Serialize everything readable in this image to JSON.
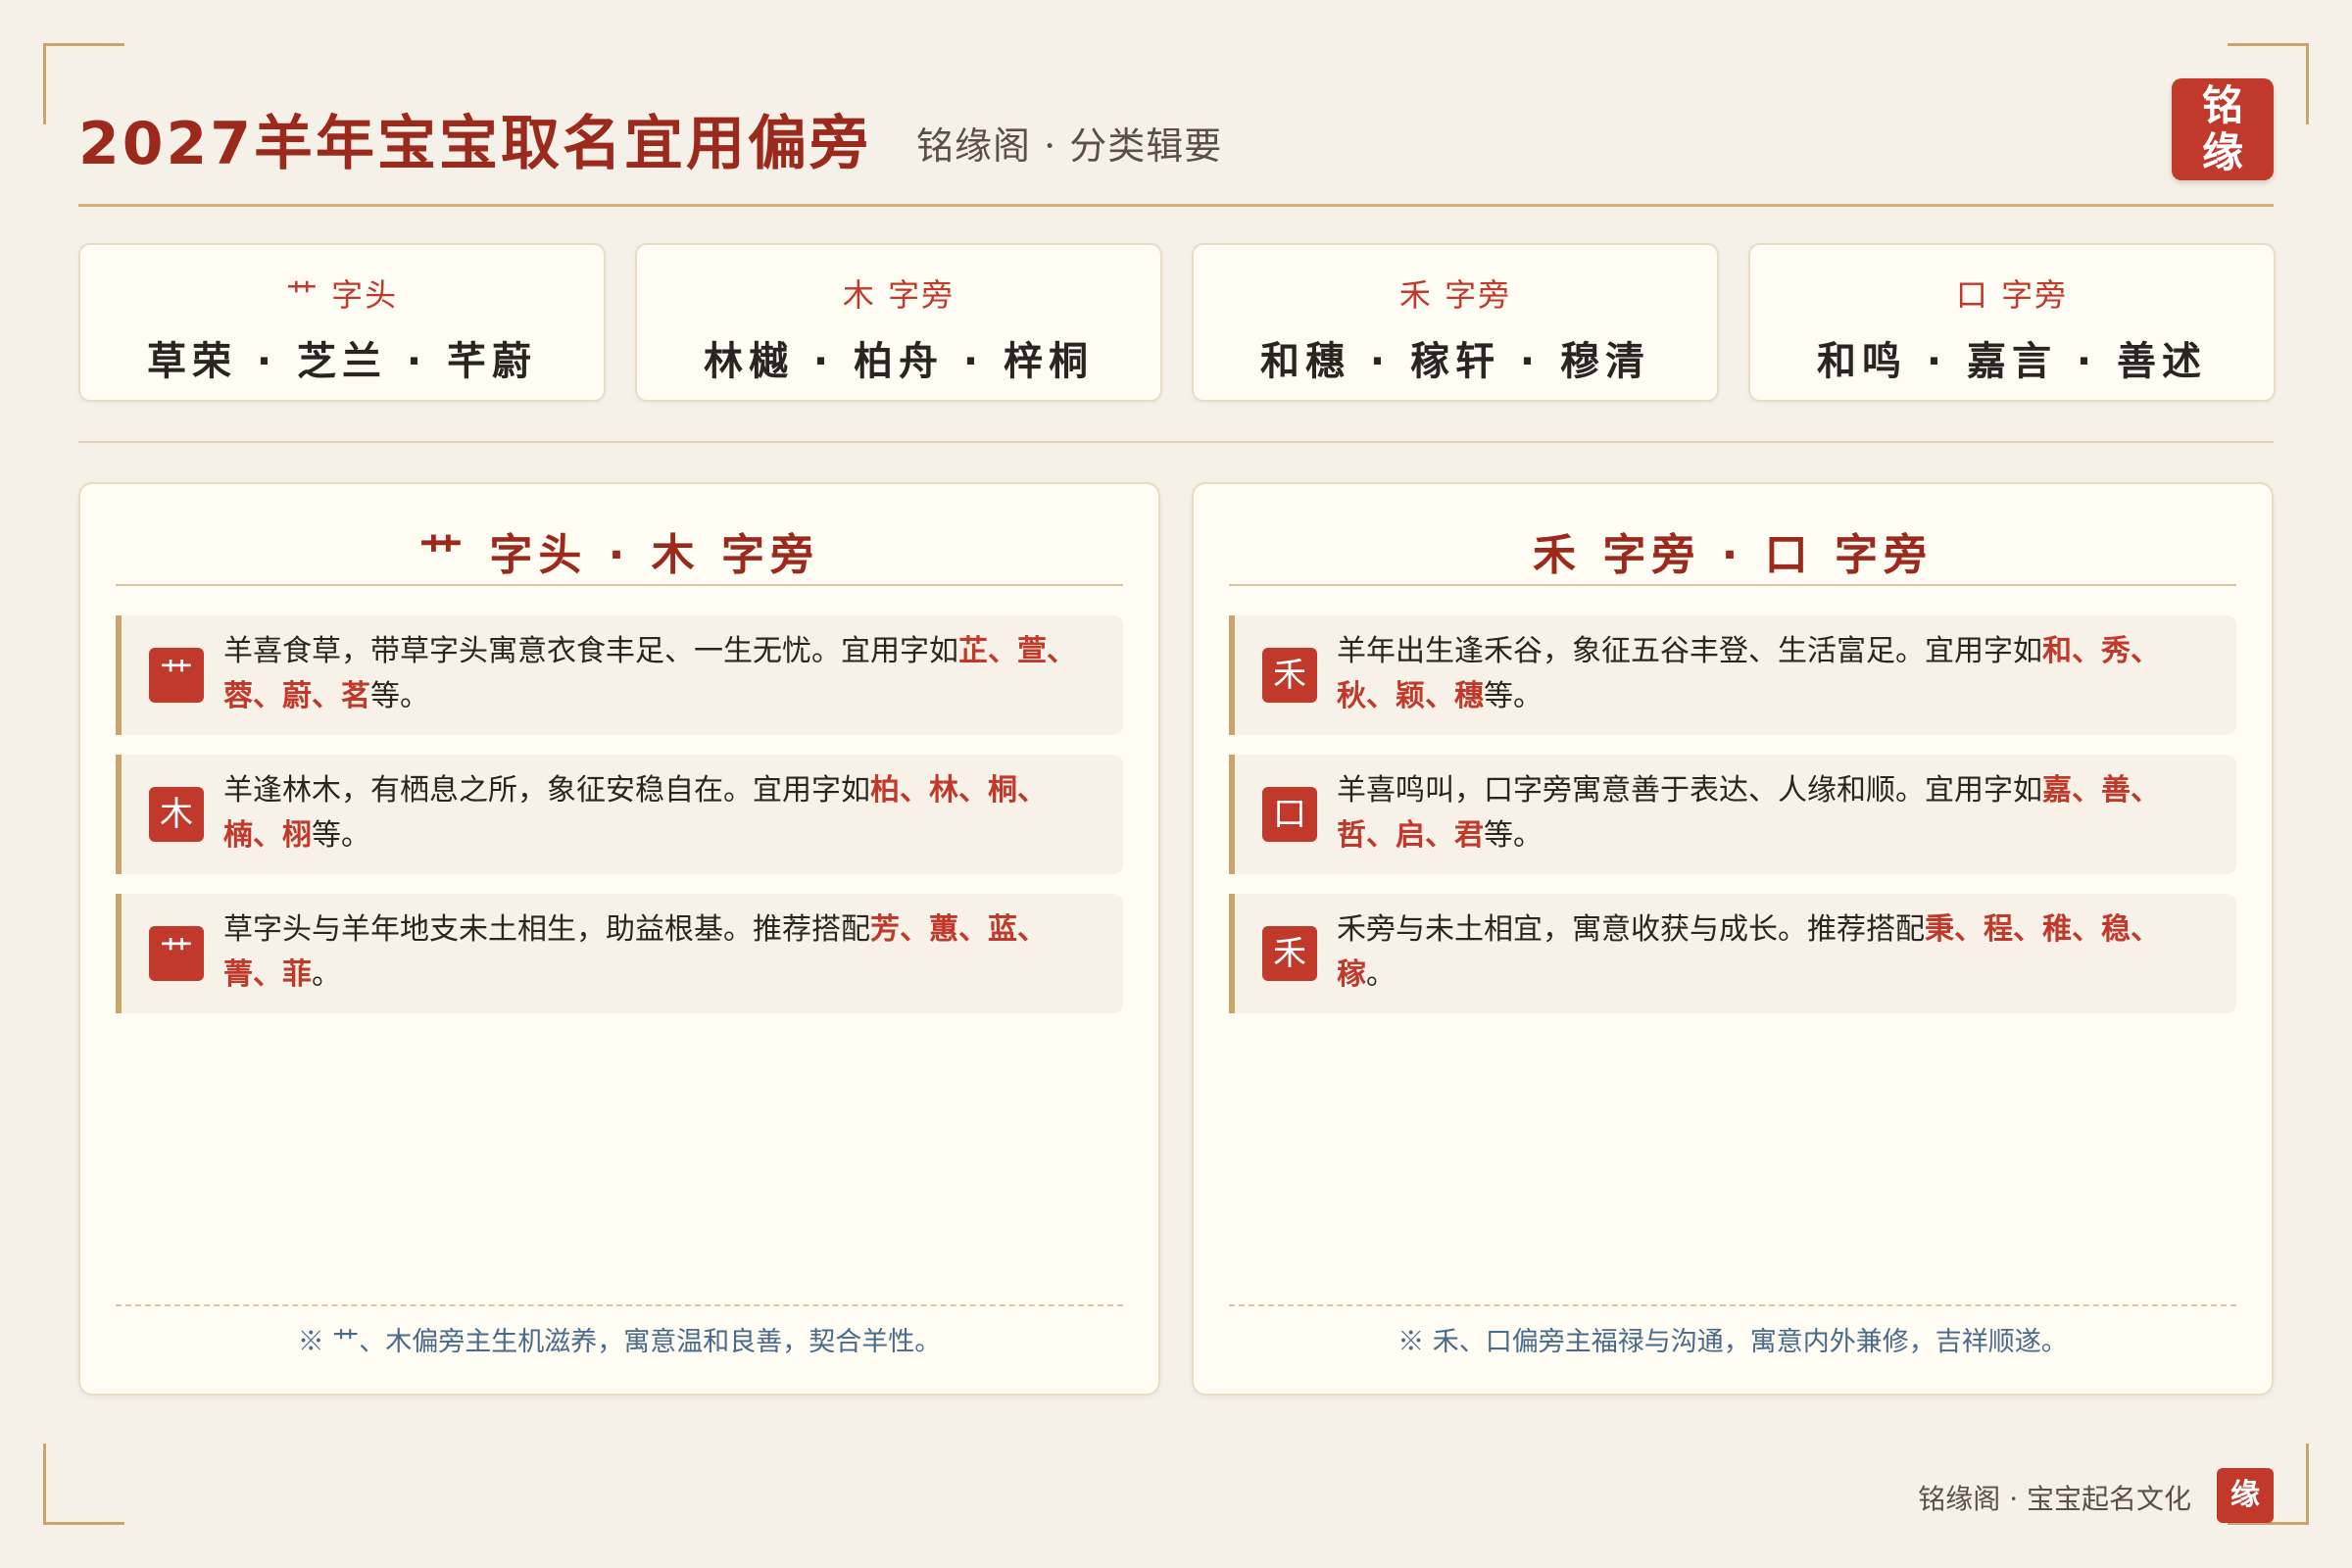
{
  "header": {
    "title": "2027羊年宝宝取名宜用偏旁",
    "subtitle": "铭缘阁 · 分类辑要",
    "seal_top": "铭",
    "seal_bottom": "缘"
  },
  "cards": [
    {
      "radical": "艹 字头",
      "names": "草荣 · 芝兰 · 芊蔚"
    },
    {
      "radical": "木 字旁",
      "names": "林樾 · 柏舟 · 梓桐"
    },
    {
      "radical": "禾 字旁",
      "names": "和穗 · 稼轩 · 穆清"
    },
    {
      "radical": "口 字旁",
      "names": "和鸣 · 嘉言 · 善述"
    }
  ],
  "panels": [
    {
      "title": "艹 字头 · 木 字旁",
      "items": [
        {
          "icon": "艹",
          "text": "羊喜食草，带草字头寓意衣食丰足、一生无忧。宜用字如",
          "chars": "芷、萱、蓉、蔚、茗",
          "suffix": "等。"
        },
        {
          "icon": "木",
          "text": "羊逢林木，有栖息之所，象征安稳自在。宜用字如",
          "chars": "柏、林、桐、楠、栩",
          "suffix": "等。"
        },
        {
          "icon": "艹",
          "text": "草字头与羊年地支未土相生，助益根基。推荐搭配",
          "chars": "芳、蕙、蓝、菁、菲",
          "suffix": "。"
        }
      ],
      "note": "※ 艹、木偏旁主生机滋养，寓意温和良善，契合羊性。"
    },
    {
      "title": "禾 字旁 · 口 字旁",
      "items": [
        {
          "icon": "禾",
          "text": "羊年出生逢禾谷，象征五谷丰登、生活富足。宜用字如",
          "chars": "和、秀、秋、颖、穗",
          "suffix": "等。"
        },
        {
          "icon": "口",
          "text": "羊喜鸣叫，口字旁寓意善于表达、人缘和顺。宜用字如",
          "chars": "嘉、善、哲、启、君",
          "suffix": "等。"
        },
        {
          "icon": "禾",
          "text": "禾旁与未土相宜，寓意收获与成长。推荐搭配",
          "chars": "秉、程、稚、稳、稼",
          "suffix": "。"
        }
      ],
      "note": "※ 禾、口偏旁主福禄与沟通，寓意内外兼修，吉祥顺遂。"
    }
  ],
  "footer": {
    "text": "铭缘阁 · 宝宝起名文化",
    "seal": "缘"
  },
  "colors": {
    "accent": "#c0392b",
    "title": "#9b2a1d",
    "gold": "#c9a46b",
    "background": "#f6f1e8",
    "note": "#4a6a8a"
  }
}
